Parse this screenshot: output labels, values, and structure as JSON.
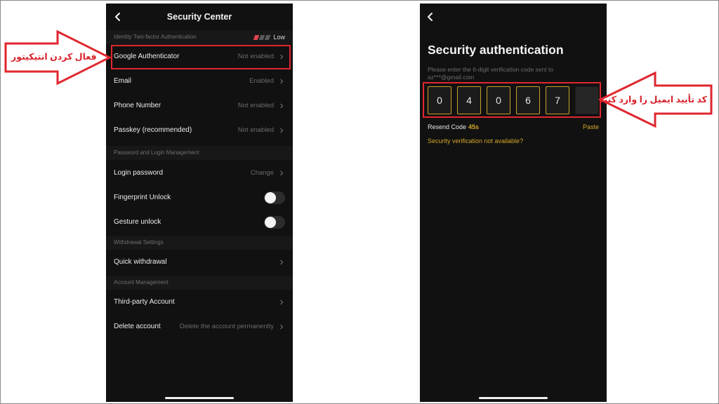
{
  "left_screen": {
    "title": "Security Center",
    "back_icon": "chevron-left-icon",
    "sections": {
      "two_factor": "Identity Two-factor Authentication",
      "password": "Password and Login Management",
      "withdrawal": "Withdrawal Settings",
      "account": "Account Management"
    },
    "risk_level": "Low",
    "rows": {
      "google_auth": {
        "label": "Google Authenticator",
        "value": "Not enabled"
      },
      "email": {
        "label": "Email",
        "value": "Enabled"
      },
      "phone": {
        "label": "Phone Number",
        "value": "Not enabled"
      },
      "passkey": {
        "label": "Passkey (recommended)",
        "value": "Not enabled"
      },
      "login_password": {
        "label": "Login password",
        "value": "Change"
      },
      "fingerprint": {
        "label": "Fingerprint Unlock",
        "enabled": false
      },
      "gesture": {
        "label": "Gesture unlock",
        "enabled": false
      },
      "quick_withdrawal": {
        "label": "Quick withdrawal"
      },
      "third_party": {
        "label": "Third-party Account"
      },
      "delete_account": {
        "label": "Delete account",
        "value": "Delete the account permanently"
      }
    }
  },
  "right_screen": {
    "back_icon": "chevron-left-icon",
    "title": "Security authentication",
    "description": "Please enter the 6-digit verification code sent to az***@gmail.com",
    "code_digits": [
      "0",
      "4",
      "0",
      "6",
      "7",
      ""
    ],
    "resend_label": "Resend Code",
    "resend_timer": "45s",
    "paste_label": "Paste",
    "not_available": "Security verification not available?"
  },
  "annotations": {
    "left_callout": "فعال کردن انتیکیتور",
    "right_callout": "کد تأیید ایمیل را وارد کنید"
  },
  "colors": {
    "accent_gold": "#d4a62a",
    "annotation_red": "#d8222b",
    "phone_bg": "#111111"
  }
}
